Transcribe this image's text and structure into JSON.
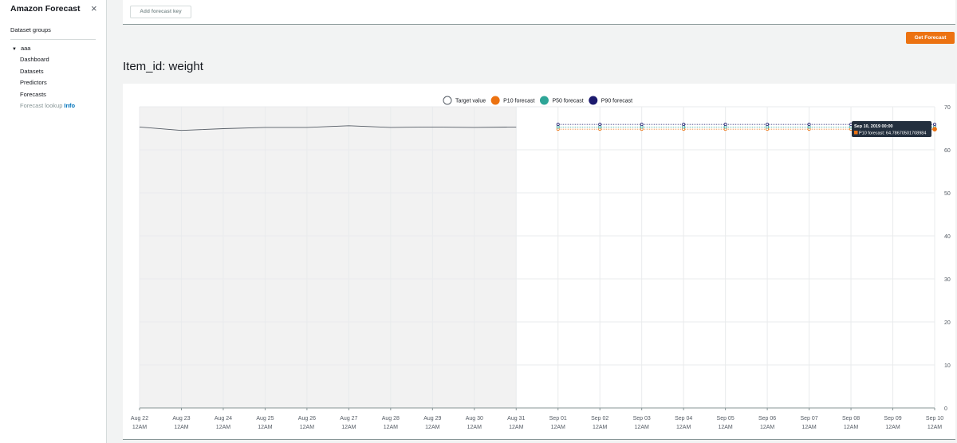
{
  "sidebar": {
    "title": "Amazon Forecast",
    "close_icon": "×",
    "section": "Dataset groups",
    "tree_caret": "▼",
    "group": "aaa",
    "items": [
      "Dashboard",
      "Datasets",
      "Predictors",
      "Forecasts"
    ],
    "lookup_label": "Forecast lookup",
    "lookup_info": "Info"
  },
  "toolbar": {
    "add_key_label": "Add forecast key",
    "get_forecast_label": "Get Forecast"
  },
  "page": {
    "title": "Item_id: weight"
  },
  "colors": {
    "target": "#545b64",
    "p10": "#ec7211",
    "p50": "#2ea597",
    "p90": "#1c1a6e",
    "accent": "#ec7211"
  },
  "chart_data": {
    "type": "line",
    "x_labels": [
      "Aug 22",
      "Aug 23",
      "Aug 24",
      "Aug 25",
      "Aug 26",
      "Aug 27",
      "Aug 28",
      "Aug 29",
      "Aug 30",
      "Aug 31",
      "Sep 01",
      "Sep 02",
      "Sep 03",
      "Sep 04",
      "Sep 05",
      "Sep 06",
      "Sep 07",
      "Sep 08",
      "Sep 09",
      "Sep 10"
    ],
    "x_sublabel": "12AM",
    "ylim": [
      0,
      70
    ],
    "y_ticks": [
      0,
      10,
      20,
      30,
      40,
      50,
      60,
      70
    ],
    "grid": true,
    "legend_position": "top-center",
    "history_shaded_range": [
      "Aug 22",
      "Aug 31"
    ],
    "series": [
      {
        "name": "Target value",
        "key": "target",
        "x_start": 0,
        "values": [
          65.3,
          64.5,
          64.9,
          65.2,
          65.2,
          65.6,
          65.2,
          65.3,
          65.2,
          65.3
        ]
      },
      {
        "name": "P10 forecast",
        "key": "p10",
        "x_start": 10,
        "values": [
          64.79,
          64.79,
          64.79,
          64.79,
          64.79,
          64.79,
          64.79,
          64.79,
          64.79,
          64.79
        ]
      },
      {
        "name": "P50 forecast",
        "key": "p50",
        "x_start": 10,
        "values": [
          65.3,
          65.3,
          65.3,
          65.3,
          65.3,
          65.3,
          65.3,
          65.3,
          65.3,
          65.3
        ]
      },
      {
        "name": "P90 forecast",
        "key": "p90",
        "x_start": 10,
        "values": [
          65.9,
          65.9,
          65.9,
          65.9,
          65.9,
          65.9,
          65.9,
          65.9,
          65.9,
          65.9
        ]
      }
    ],
    "tooltip": {
      "title": "Sep 10, 2019 00:00",
      "text": "P10 forecast: 64.78670501708984",
      "series": "p10",
      "x_index": 19
    }
  }
}
